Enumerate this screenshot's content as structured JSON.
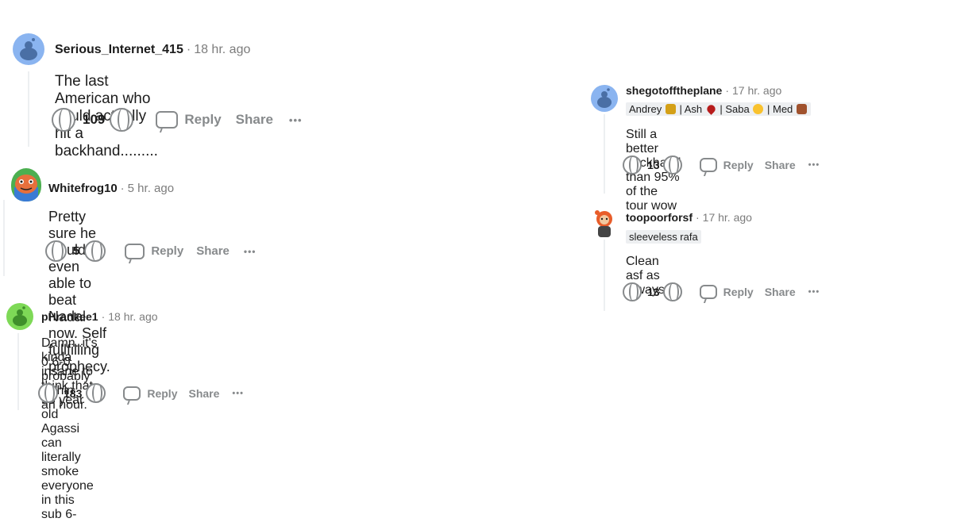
{
  "comments": [
    {
      "username": "Serious_Internet_415",
      "time": "18 hr. ago",
      "body": "The last American who could actually hit a backhand.........",
      "votes": "109",
      "reply_label": "Reply",
      "share_label": "Share",
      "more_label": "•••",
      "avatar_color": "#8ab4f0"
    },
    {
      "username": "Whitefrog10",
      "time": "5 hr. ago",
      "body": "Pretty sure he would be even able to beat Nadal now. Self fullfilling prophecy.",
      "votes": "5",
      "reply_label": "Reply",
      "share_label": "Share",
      "more_label": "•••",
      "avatar_color": "#4caf50"
    },
    {
      "username": "pHrankee1",
      "time": "18 hr. ago",
      "body_line1": "Damn..it's kinda insane to think that 55 year old Agassi can literally smoke everyone in this sub 6-",
      "body_line2": "0 6-0 probably within an hour.",
      "votes": "183",
      "reply_label": "Reply",
      "share_label": "Share",
      "more_label": "•••",
      "avatar_color": "#7ed957"
    },
    {
      "username": "shegotofftheplane",
      "time": "17 hr. ago",
      "flair": {
        "p1": "Andrey",
        "p2": "| Ash",
        "p3": "| Saba",
        "p4": "| Med"
      },
      "body": "Still a better backhand than 95% of the tour wow",
      "votes": "13",
      "reply_label": "Reply",
      "share_label": "Share",
      "more_label": "•••",
      "avatar_color": "#8ab4f0"
    },
    {
      "username": "toopoorforsf",
      "time": "17 hr. ago",
      "flair": "sleeveless rafa",
      "body": "Clean asf as always",
      "votes": "13",
      "reply_label": "Reply",
      "share_label": "Share",
      "more_label": "•••",
      "avatar_color": "#f4a261"
    }
  ],
  "separator": "·"
}
